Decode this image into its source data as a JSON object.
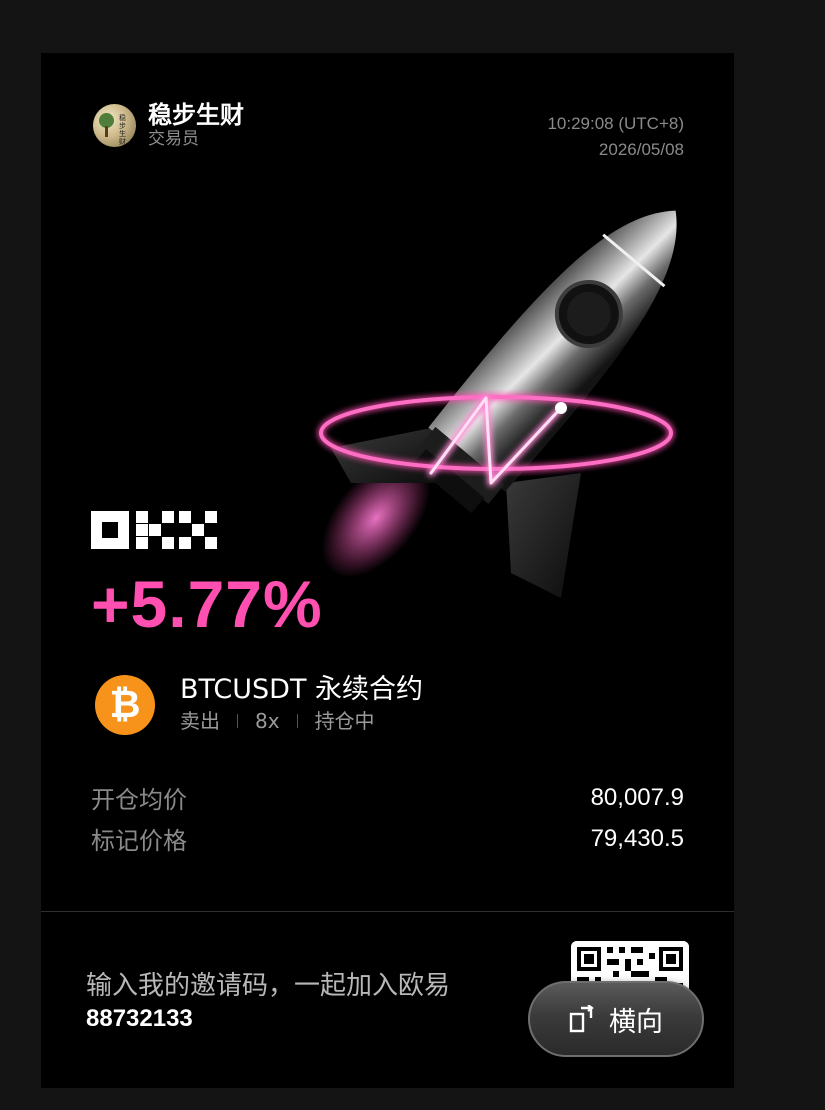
{
  "trader": {
    "name": "稳步生财",
    "role": "交易员",
    "avatar_text": "稳步生财"
  },
  "timestamp": {
    "time": "10:29:08 (UTC+8)",
    "date": "2026/05/08"
  },
  "brand": {
    "logo_text": "OKX",
    "accent_color": "#ff4fb0"
  },
  "pnl": {
    "value": "+5.77%"
  },
  "contract": {
    "coin_icon": "bitcoin-icon",
    "name": "BTCUSDT 永续合约",
    "side": "卖出",
    "leverage": "8x",
    "status": "持仓中"
  },
  "stats": [
    {
      "label": "开仓均价",
      "value": "80,007.9"
    },
    {
      "label": "标记价格",
      "value": "79,430.5"
    }
  ],
  "invite": {
    "text": "输入我的邀请码，一起加入欧易",
    "code": "88732133"
  },
  "orientation_button": {
    "label": "横向",
    "icon": "rotate-landscape-icon"
  }
}
